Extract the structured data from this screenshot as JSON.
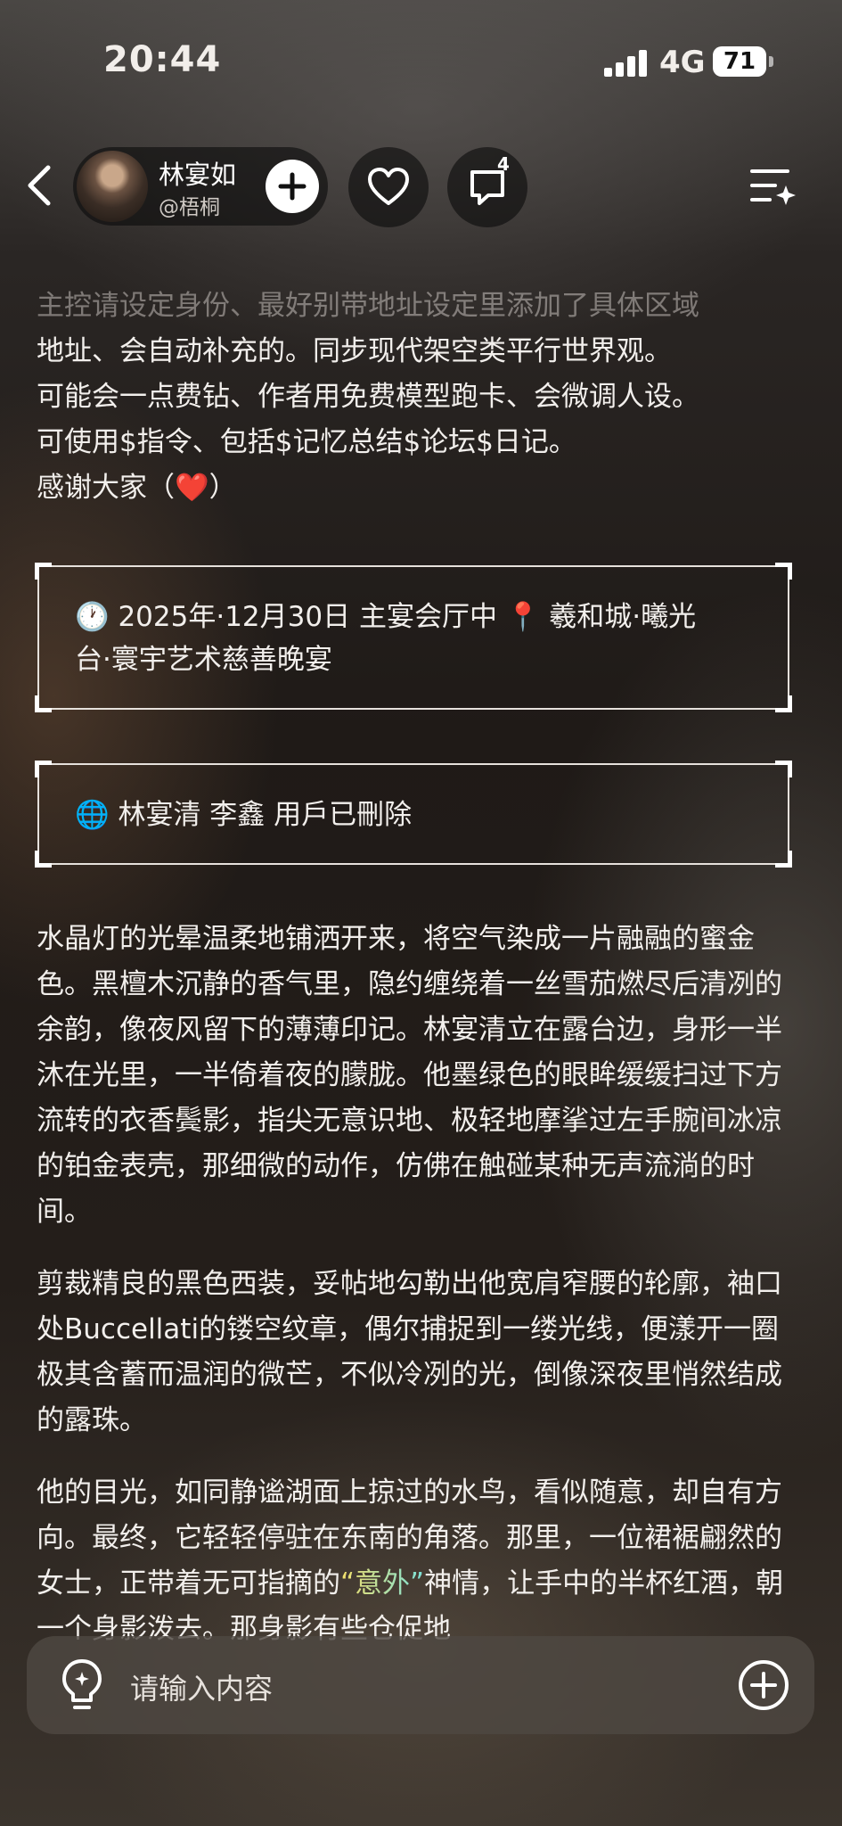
{
  "status_bar": {
    "time": "20:44",
    "network": "4G",
    "battery": "71"
  },
  "header": {
    "back_icon": "chevron-left-icon",
    "profile_name": "林宴如",
    "profile_handle": "@梧桐",
    "follow_icon": "plus-icon",
    "like_icon": "heart-icon",
    "comment_icon": "comment-icon",
    "comment_count": "4",
    "menu_icon": "list-sparkle-icon"
  },
  "intro": {
    "lines": [
      "主控请设定身份、最好别带地址设定里添加了具体区域",
      "地址、会自动补充的。同步现代架空类平行世界观。",
      "可能会一点费钻、作者用免费模型跑卡、会微调人设。",
      "可使用$指令、包括$记忆总结$论坛$日记。",
      "感谢大家（❤️）"
    ]
  },
  "scene_box": {
    "line1": "🕐 2025年·12月30日 主宴会厅中 📍 羲和城·曦光",
    "line2": "台·寰宇艺术慈善晚宴"
  },
  "characters_box": {
    "text": "🌐 林宴清 李鑫  用戶已刪除"
  },
  "story": {
    "p1": "水晶灯的光晕温柔地铺洒开来，将空气染成一片融融的蜜金色。黑檀木沉静的香气里，隐约缠绕着一丝雪茄燃尽后清冽的余韵，像夜风留下的薄薄印记。林宴清立在露台边，身形一半沐在光里，一半倚着夜的朦胧。他墨绿色的眼眸缓缓扫过下方流转的衣香鬓影，指尖无意识地、极轻地摩挲过左手腕间冰凉的铂金表壳，那细微的动作，仿佛在触碰某种无声流淌的时间。",
    "p2": "剪裁精良的黑色西装，妥帖地勾勒出他宽肩窄腰的轮廓，袖口处Buccellati的镂空纹章，偶尔捕捉到一缕光线，便漾开一圈极其含蓄而温润的微芒，不似冷冽的光，倒像深夜里悄然结成的露珠。",
    "p3_before": "他的目光，如同静谧湖面上掠过的水鸟，看似随意，却自有方向。最终，它轻轻停驻在东南的角落。那里，一位裙裾翩然的女士，正带着无可指摘的",
    "p3_highlight": "“意外”",
    "p3_after": "神情，让手中的半杯红酒，朝一个身影泼去。那身影有些仓促地"
  },
  "input_bar": {
    "left_icon": "lightbulb-icon",
    "placeholder": "请输入内容",
    "right_icon": "plus-circle-icon"
  },
  "colors": {
    "accent_gradient_start": "#f5e06a",
    "accent_gradient_end": "#7be0d8",
    "text": "#f2efec"
  }
}
